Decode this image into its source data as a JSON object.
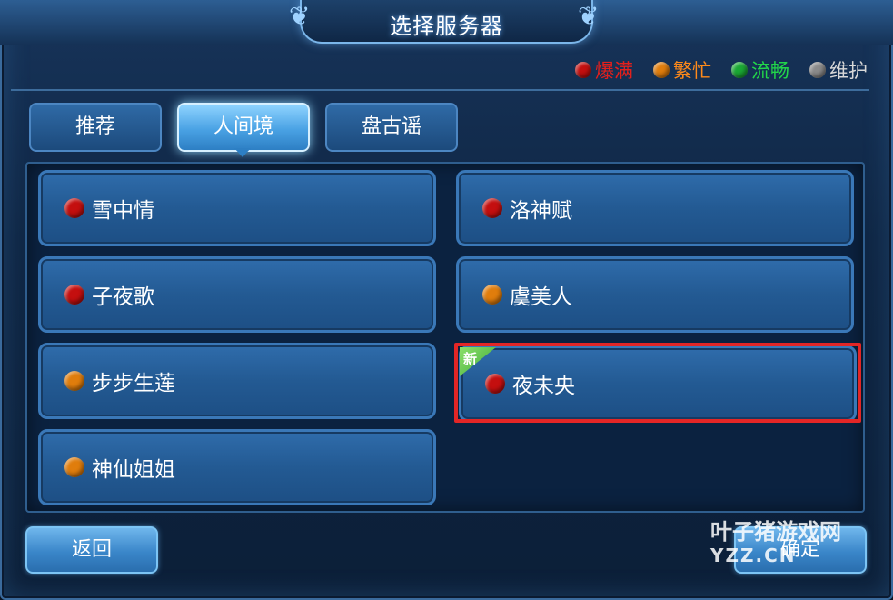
{
  "title": "选择服务器",
  "legend": [
    {
      "label": "爆满",
      "color": "#e3201c",
      "dot": "#c40f0f",
      "icon": "red-status-dot-icon"
    },
    {
      "label": "繁忙",
      "color": "#ff8a1a",
      "dot": "#e07d0c",
      "icon": "orange-status-dot-icon"
    },
    {
      "label": "流畅",
      "color": "#22d64a",
      "dot": "#1aa834",
      "icon": "green-status-dot-icon"
    },
    {
      "label": "维护",
      "color": "#d8d8d8",
      "dot": "#8a8a8a",
      "icon": "gray-status-dot-icon"
    }
  ],
  "tabs": [
    {
      "label": "推荐",
      "active": false
    },
    {
      "label": "人间境",
      "active": true
    },
    {
      "label": "盘古谣",
      "active": false
    }
  ],
  "servers": [
    {
      "name": "雪中情",
      "status": "爆满",
      "dot": "#c40f0f"
    },
    {
      "name": "洛神赋",
      "status": "爆满",
      "dot": "#c40f0f"
    },
    {
      "name": "子夜歌",
      "status": "爆满",
      "dot": "#c40f0f"
    },
    {
      "name": "虞美人",
      "status": "繁忙",
      "dot": "#e07d0c"
    },
    {
      "name": "步步生莲",
      "status": "繁忙",
      "dot": "#e07d0c"
    },
    {
      "name": "夜未央",
      "status": "爆满",
      "dot": "#c40f0f",
      "new": true,
      "selected": true
    },
    {
      "name": "神仙姐姐",
      "status": "繁忙",
      "dot": "#e07d0c"
    }
  ],
  "new_badge": "新",
  "buttons": {
    "back": "返回",
    "confirm": "确定"
  },
  "watermark": {
    "line1": "叶子猪游戏网",
    "line2": "YZZ.CN"
  }
}
